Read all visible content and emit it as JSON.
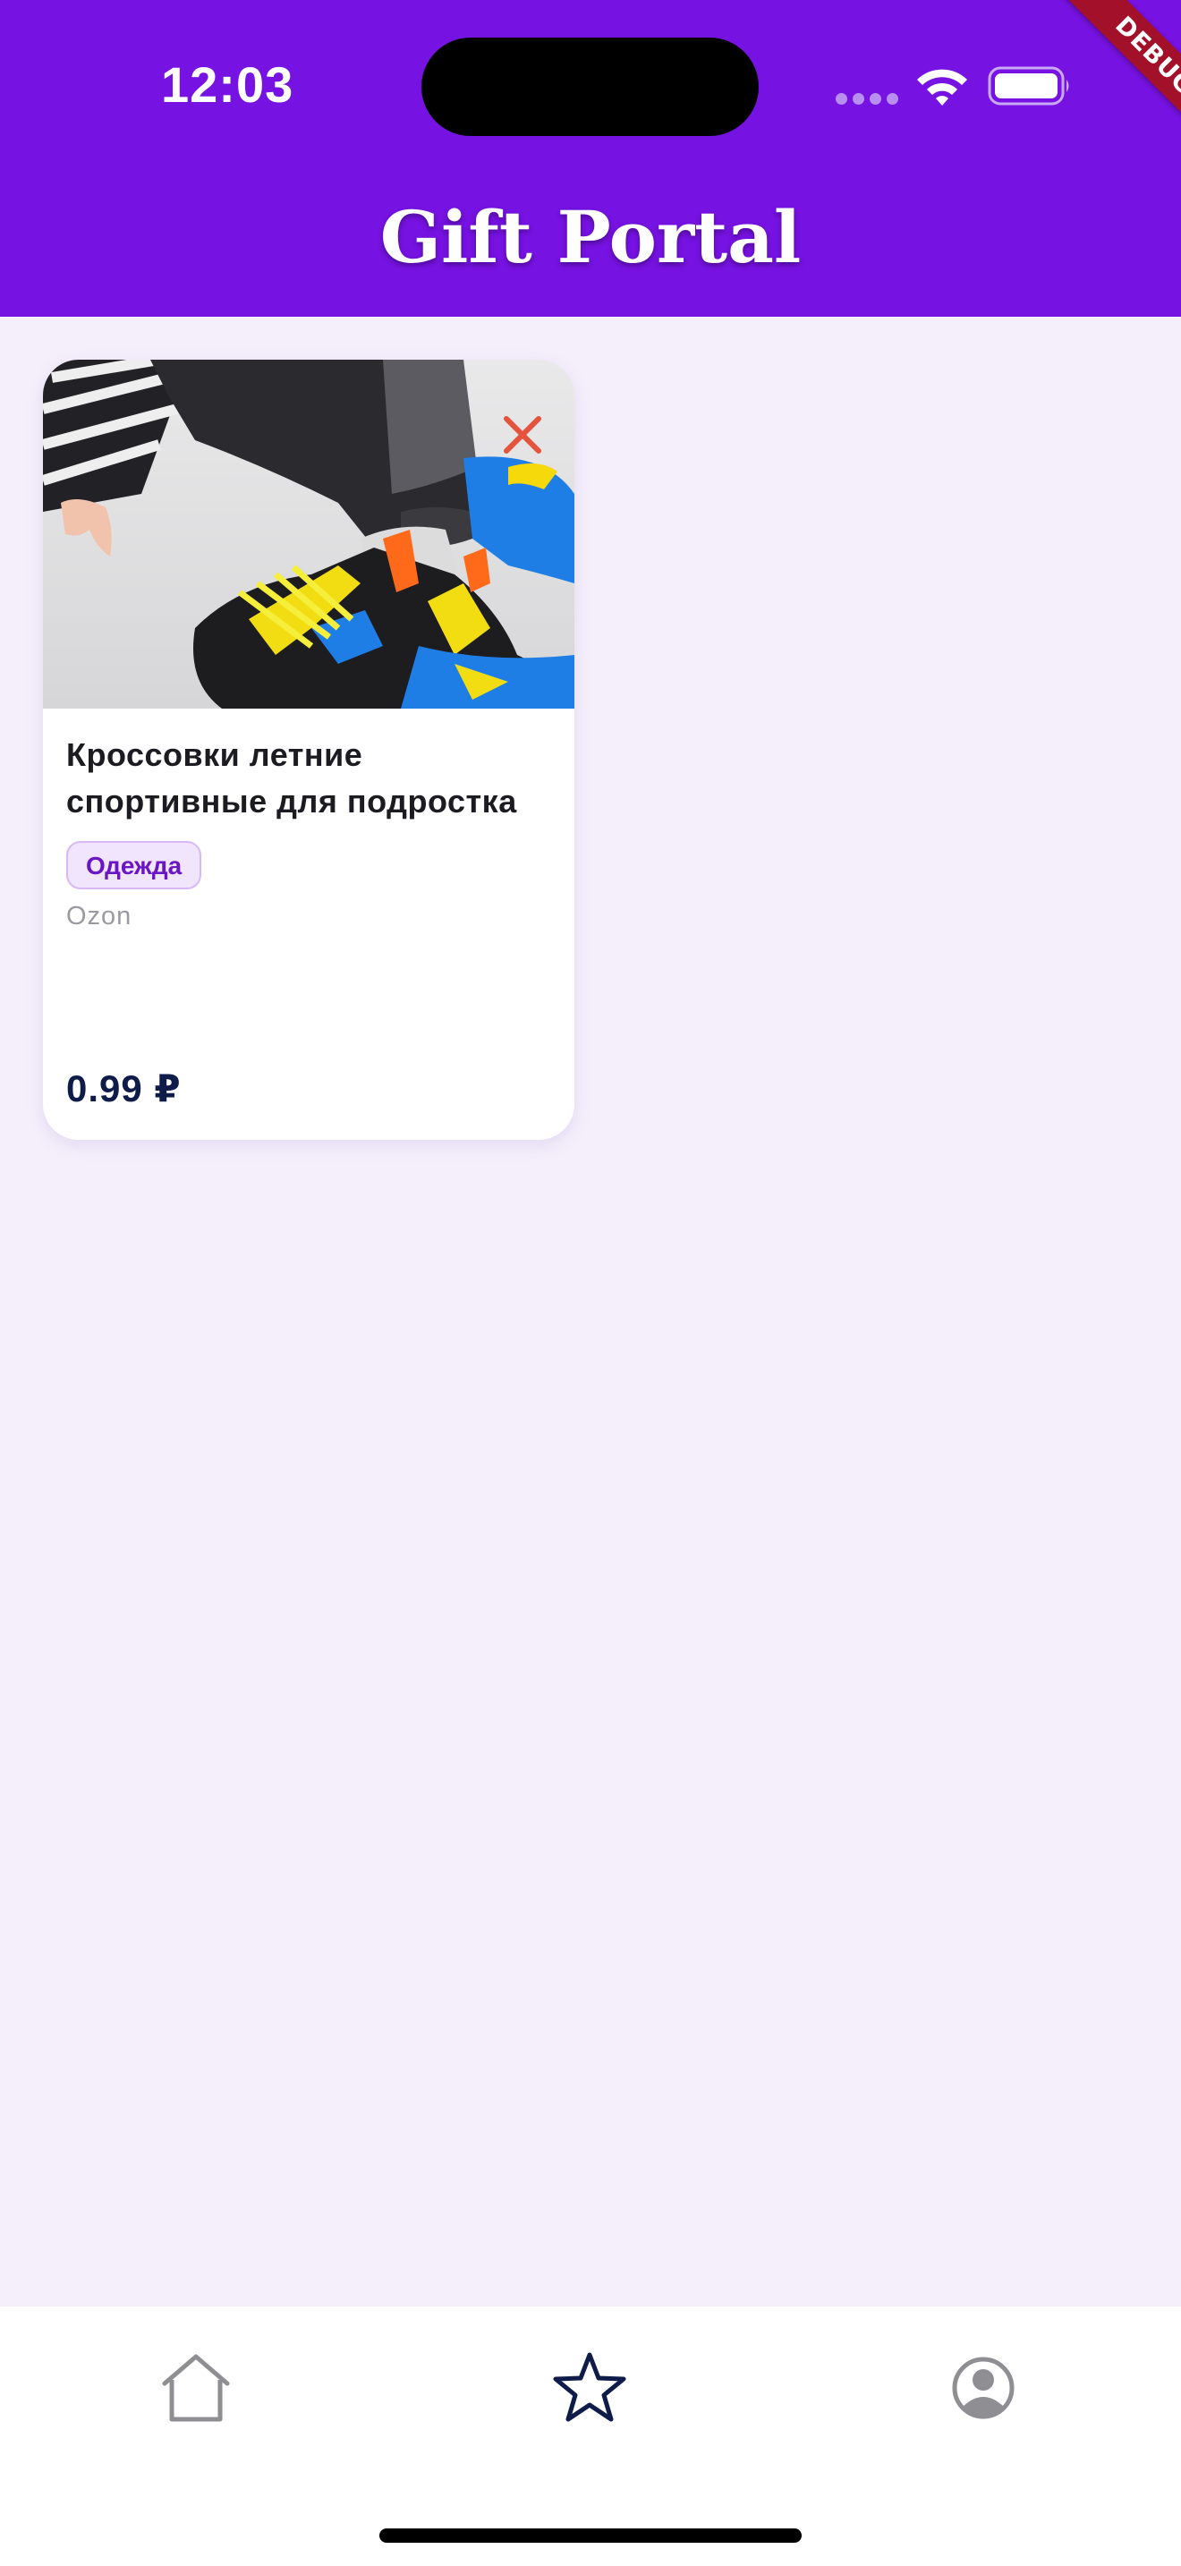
{
  "status_bar": {
    "time": "12:03",
    "debug_label": "DEBUG"
  },
  "header": {
    "title": "Gift Portal",
    "background_color": "#7612e2"
  },
  "product": {
    "title": "Кроссовки летние спортивные для подростка",
    "category": "Одежда",
    "store": "Ozon",
    "price": "0.99 ₽",
    "image_icon": "sneaker-photo",
    "remove_icon": "close-icon",
    "remove_color": "#e5533d"
  },
  "bottom_nav": {
    "items": [
      {
        "icon": "home-icon",
        "active": false
      },
      {
        "icon": "star-icon",
        "active": true
      },
      {
        "icon": "profile-icon",
        "active": false
      }
    ],
    "active_color": "#0f1c4a",
    "inactive_color": "#8e8e93"
  }
}
